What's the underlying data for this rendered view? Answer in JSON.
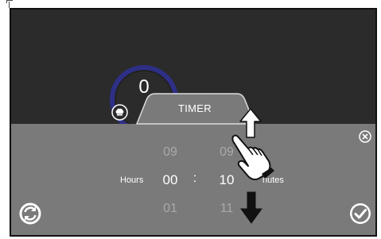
{
  "gauge": {
    "value": "0"
  },
  "timer": {
    "title": "TIMER",
    "hours_label": "Hours",
    "minutes_label": "nutes",
    "separator": ":",
    "hours": {
      "prev": "09",
      "current": "00",
      "next": "01"
    },
    "minutes": {
      "prev": "09",
      "current": "10",
      "next": "11"
    }
  },
  "colors": {
    "screen_bg": "#2b2b2b",
    "panel_bg": "#7a7a7a",
    "gauge_ring": "#2e2f86"
  },
  "icons": [
    "chef-hat-icon",
    "close-icon",
    "refresh-icon",
    "confirm-check-icon",
    "arrow-up-icon",
    "arrow-down-icon",
    "pointing-hand-icon"
  ]
}
